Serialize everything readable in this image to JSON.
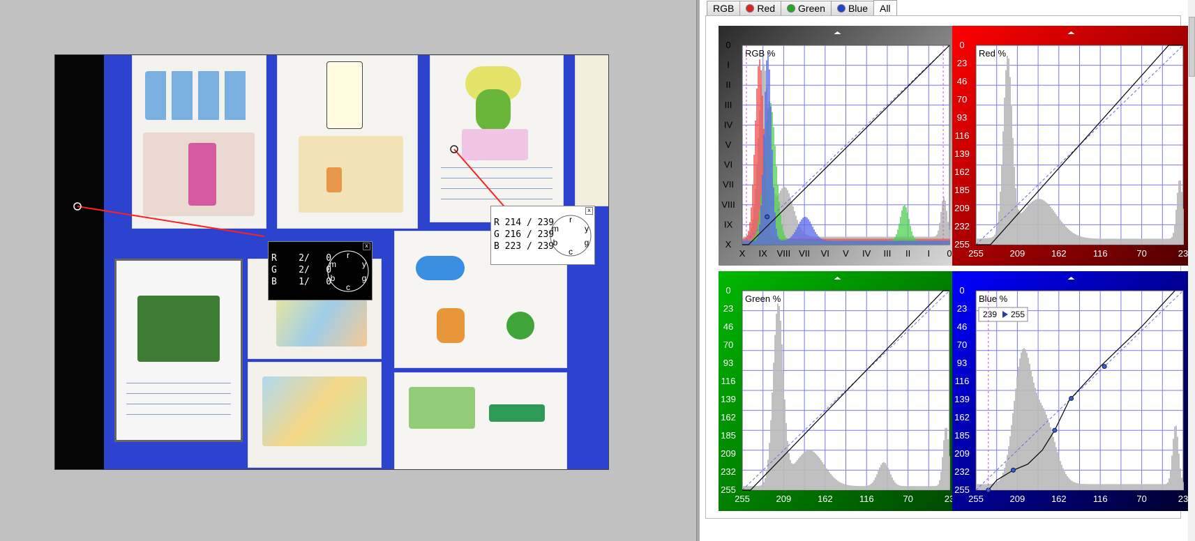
{
  "tabs": [
    {
      "label": "RGB",
      "icon": "",
      "active": false
    },
    {
      "label": "Red",
      "icon": "red-dot-icon",
      "color": "#d22",
      "active": false
    },
    {
      "label": "Green",
      "icon": "green-dot-icon",
      "color": "#2a2",
      "active": false
    },
    {
      "label": "Blue",
      "icon": "blue-dot-icon",
      "color": "#24c",
      "active": false
    },
    {
      "label": "All",
      "icon": "",
      "active": true
    }
  ],
  "probes": {
    "dark": {
      "rows": [
        "R    2/   0",
        "G    2/   0",
        "B    1/   0"
      ],
      "dial": [
        "r",
        "y",
        "g",
        "c",
        "b",
        "m"
      ]
    },
    "light": {
      "rows": [
        "R 214 / 239",
        "G 216 / 239",
        "B 223 / 239"
      ],
      "dial": [
        "r",
        "y",
        "g",
        "c",
        "b",
        "m"
      ]
    }
  },
  "panels": {
    "rgb": {
      "title": "RGB %",
      "bg": "#7a7a7a",
      "y_labels": [
        "0",
        "I",
        "II",
        "III",
        "IV",
        "V",
        "VI",
        "VII",
        "VIII",
        "IX",
        "X"
      ],
      "x_labels": [
        "X",
        "IX",
        "VIII",
        "VII",
        "VI",
        "V",
        "IV",
        "III",
        "II",
        "I",
        "0"
      ]
    },
    "red": {
      "title": "Red %",
      "bg": "#aa0000",
      "y_labels": [
        "0",
        "23",
        "46",
        "70",
        "93",
        "116",
        "139",
        "162",
        "185",
        "209",
        "232",
        "255"
      ],
      "x_labels": [
        "255",
        "209",
        "162",
        "116",
        "70",
        "23"
      ]
    },
    "green": {
      "title": "Green %",
      "bg": "#009000",
      "y_labels": [
        "0",
        "23",
        "46",
        "70",
        "93",
        "116",
        "139",
        "162",
        "185",
        "209",
        "232",
        "255"
      ],
      "x_labels": [
        "255",
        "209",
        "162",
        "116",
        "70",
        "23"
      ]
    },
    "blue": {
      "title": "Blue %",
      "bg": "#0000b0",
      "y_labels": [
        "0",
        "23",
        "46",
        "70",
        "93",
        "116",
        "139",
        "162",
        "185",
        "209",
        "232",
        "255"
      ],
      "x_labels": [
        "255",
        "209",
        "162",
        "116",
        "70",
        "23"
      ],
      "input_low": "239",
      "input_high": "255"
    }
  }
}
